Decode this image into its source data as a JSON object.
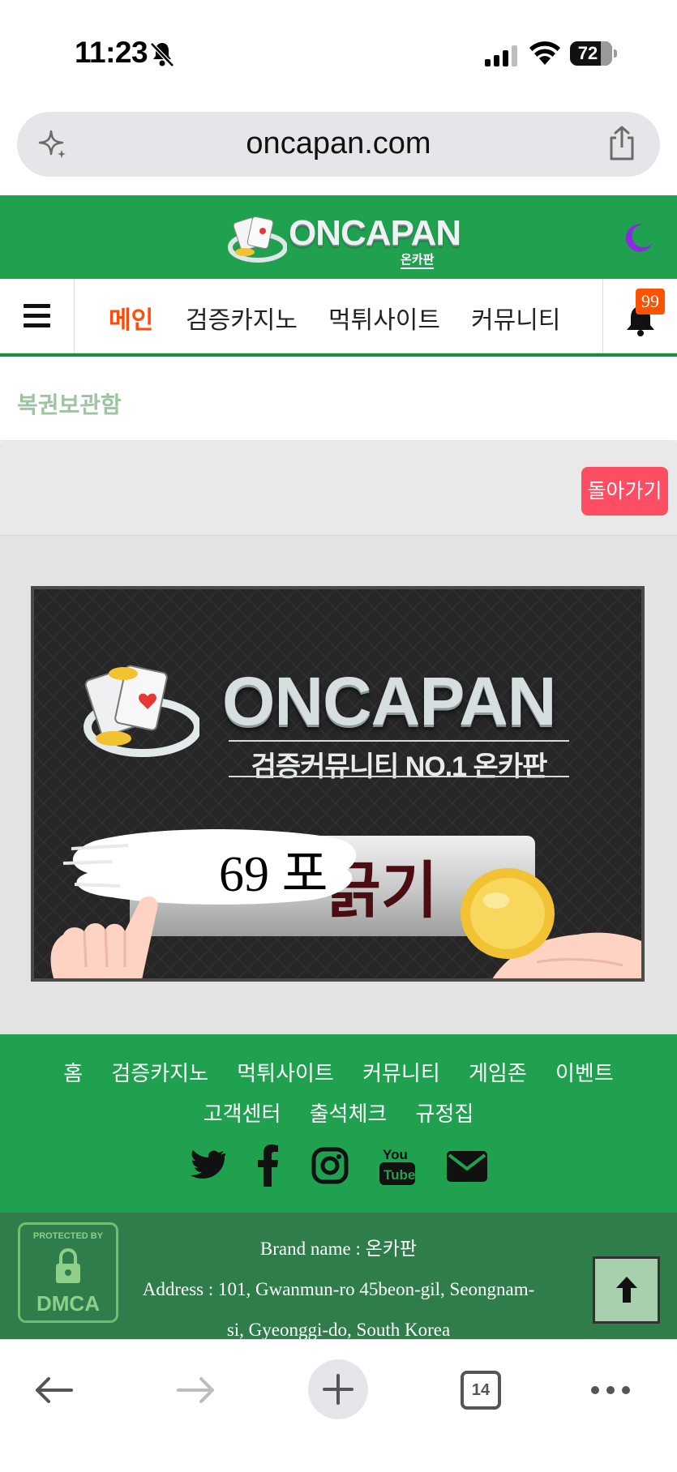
{
  "status_bar": {
    "time": "11:23",
    "battery": "72",
    "icons": [
      "bell-slash-icon",
      "cellular-signal-icon",
      "wifi-icon",
      "battery-icon"
    ]
  },
  "browser": {
    "url": "oncapan.com",
    "tab_count": "14",
    "icons": [
      "sparkle-icon",
      "share-icon",
      "back-arrow-icon",
      "forward-arrow-icon",
      "plus-icon",
      "tabs-icon",
      "more-icon"
    ]
  },
  "header": {
    "logo_text": "ONCAPAN",
    "logo_sub": "온카판",
    "theme_icon": "moon-icon"
  },
  "nav": {
    "items": [
      {
        "label": "메인",
        "active": true
      },
      {
        "label": "검증카지노",
        "active": false
      },
      {
        "label": "먹튀사이트",
        "active": false
      },
      {
        "label": "커뮤니티",
        "active": false
      }
    ],
    "notification_count": "99"
  },
  "page": {
    "title": "복권보관함",
    "back_label": "돌아가기"
  },
  "banner": {
    "logo_text": "ONCAPAN",
    "tagline": "검증커뮤니티 NO.1 온카판",
    "button_text": "긁기",
    "points_text": "69 포"
  },
  "footer": {
    "links_row1": [
      "홈",
      "검증카지노",
      "먹튀사이트",
      "커뮤니티",
      "게임존",
      "이벤트"
    ],
    "links_row2": [
      "고객센터",
      "출석체크",
      "규정집"
    ],
    "social_icons": [
      "twitter-icon",
      "facebook-icon",
      "instagram-icon",
      "youtube-icon",
      "email-icon"
    ],
    "brand_line": "Brand name : 온카판",
    "address_line1": "Address : 101, Gwanmun-ro 45beon-gil, Seongnam-",
    "address_line2": "si, Gyeonggi-do, South Korea",
    "dmca_top": "PROTECTED BY",
    "dmca_bottom": "DMCA"
  },
  "colors": {
    "brand_green": "#1fa14f",
    "footer_dark_green": "#2e7d4a",
    "active_nav": "#ff4a0a",
    "back_button": "#ff4d63",
    "moon": "#8a2be2"
  }
}
